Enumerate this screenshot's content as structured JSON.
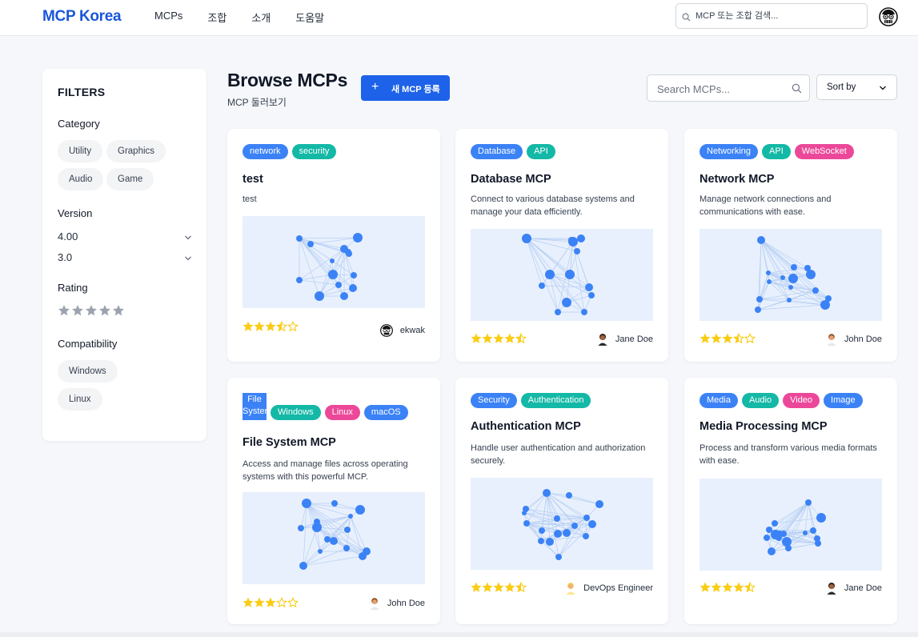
{
  "nav": {
    "brand": "MCP Korea",
    "links": [
      "MCPs",
      "조합",
      "소개",
      "도움말"
    ],
    "search_placeholder": "MCP 또는 조합 검색..."
  },
  "sidebar": {
    "title": "FILTERS",
    "category": {
      "label": "Category",
      "chips": [
        "Utility",
        "Graphics",
        "Audio",
        "Game"
      ]
    },
    "version": {
      "label": "Version",
      "options": [
        "4.00",
        "3.0"
      ]
    },
    "rating": {
      "label": "Rating",
      "value": 0,
      "max": 5
    },
    "compatibility": {
      "label": "Compatibility",
      "chips": [
        "Windows",
        "Linux"
      ]
    }
  },
  "header": {
    "title": "Browse MCPs",
    "subtitle": "MCP 둘러보기",
    "new_button": "새 MCP 등록",
    "search_placeholder": "Search MCPs...",
    "sort_label": "Sort by"
  },
  "colors": {
    "brand": "#1a56db",
    "primary_button": "#1d62e8",
    "tag_blue": "#3b82f6",
    "tag_teal": "#14b8a6",
    "tag_pink": "#ec4899",
    "star": "#facc15",
    "graph_bg": "#e8f0fd",
    "node": "#3b82f6"
  },
  "cards": [
    {
      "tags": [
        {
          "text": "network",
          "color": "blue"
        },
        {
          "text": "security",
          "color": "teal"
        }
      ],
      "title": "test",
      "description": "test",
      "rating": 3.5,
      "author": "ekwak"
    },
    {
      "tags": [
        {
          "text": "Database",
          "color": "blue"
        },
        {
          "text": "API",
          "color": "teal"
        }
      ],
      "title": "Database MCP",
      "description": "Connect to various database systems and manage your data efficiently.",
      "rating": 4.5,
      "author": "Jane Doe"
    },
    {
      "tags": [
        {
          "text": "Networking",
          "color": "blue"
        },
        {
          "text": "API",
          "color": "teal"
        },
        {
          "text": "WebSocket",
          "color": "pink"
        }
      ],
      "title": "Network MCP",
      "description": "Manage network connections and communications with ease.",
      "rating": 3.5,
      "author": "John Doe"
    },
    {
      "tags": [
        {
          "text": "File System",
          "color": "blue"
        },
        {
          "text": "Windows",
          "color": "teal"
        },
        {
          "text": "Linux",
          "color": "pink"
        },
        {
          "text": "macOS",
          "color": "blue"
        }
      ],
      "title": "File System MCP",
      "description": "Access and manage files across operating systems with this powerful MCP.",
      "rating": 3,
      "author": "John Doe"
    },
    {
      "tags": [
        {
          "text": "Security",
          "color": "blue"
        },
        {
          "text": "Authentication",
          "color": "teal"
        }
      ],
      "title": "Authentication MCP",
      "description": "Handle user authentication and authorization securely.",
      "rating": 4.5,
      "author": "DevOps Engineer"
    },
    {
      "tags": [
        {
          "text": "Media",
          "color": "blue"
        },
        {
          "text": "Audio",
          "color": "teal"
        },
        {
          "text": "Video",
          "color": "pink"
        },
        {
          "text": "Image",
          "color": "blue"
        }
      ],
      "title": "Media Processing MCP",
      "description": "Process and transform various media formats with ease.",
      "rating": 4.5,
      "author": "Jane Doe"
    }
  ]
}
